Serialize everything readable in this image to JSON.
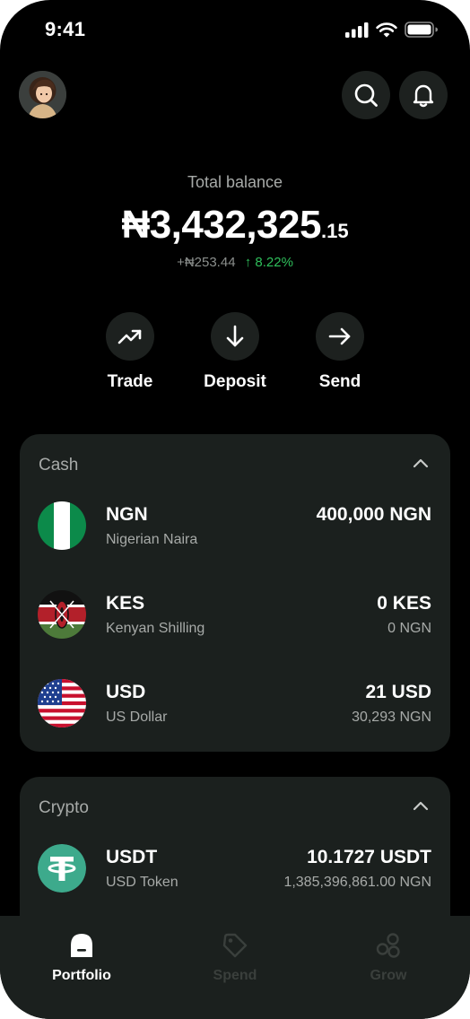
{
  "status_bar": {
    "time": "9:41"
  },
  "header": {
    "avatar": "user-avatar",
    "search_icon": "search-icon",
    "notifications_icon": "bell-icon"
  },
  "balance": {
    "label": "Total balance",
    "amount_main": "₦3,432,325",
    "amount_cents": ".15",
    "change_amount": "+₦253.44",
    "change_arrow": "↑",
    "change_percent": "8.22%"
  },
  "actions": [
    {
      "label": "Trade",
      "icon": "trending-up-icon"
    },
    {
      "label": "Deposit",
      "icon": "arrow-down-icon"
    },
    {
      "label": "Send",
      "icon": "arrow-right-icon"
    }
  ],
  "cash": {
    "title": "Cash",
    "items": [
      {
        "code": "NGN",
        "name": "Nigerian Naira",
        "amount": "400,000 NGN",
        "sub": ""
      },
      {
        "code": "KES",
        "name": "Kenyan Shilling",
        "amount": "0 KES",
        "sub": "0 NGN"
      },
      {
        "code": "USD",
        "name": "US Dollar",
        "amount": "21 USD",
        "sub": "30,293 NGN"
      }
    ]
  },
  "crypto": {
    "title": "Crypto",
    "items": [
      {
        "code": "USDT",
        "name": "USD Token",
        "amount": "10.1727 USDT",
        "sub": "1,385,396,861.00 NGN"
      }
    ]
  },
  "tabs": [
    {
      "label": "Portfolio",
      "active": true
    },
    {
      "label": "Spend",
      "active": false
    },
    {
      "label": "Grow",
      "active": false
    }
  ],
  "colors": {
    "background": "#000000",
    "card": "#1b201e",
    "positive": "#2fbf5b",
    "tether": "#3daa8c"
  }
}
